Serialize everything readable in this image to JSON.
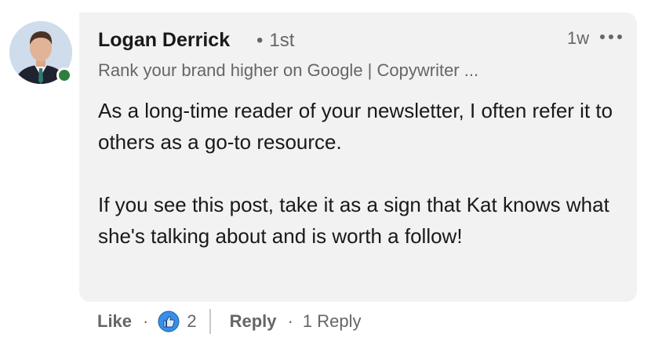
{
  "comment": {
    "author": {
      "name": "Logan Derrick",
      "connection_degree": "1st",
      "degree_separator": "•",
      "headline": "Rank your brand higher on Google | Copywriter ...",
      "avatar_icon": "person-photo-avatar",
      "online": true,
      "presence_color": "#2f7d3f"
    },
    "timestamp": "1w",
    "more_icon": "ellipsis-icon",
    "body_paragraphs": [
      "As a long-time reader of your newsletter, I often refer it to others as a go-to resource.",
      "If you see this post, take it as a sign that Kat knows what she's talking about and is worth a follow!"
    ],
    "bubble_color": "#f2f2f2"
  },
  "actions": {
    "like_label": "Like",
    "separator": "·",
    "reaction_icon": "like-reaction-icon",
    "reaction_color": "#378fe9",
    "reaction_count": "2",
    "reply_label": "Reply",
    "reply_count_label": "1 Reply"
  }
}
